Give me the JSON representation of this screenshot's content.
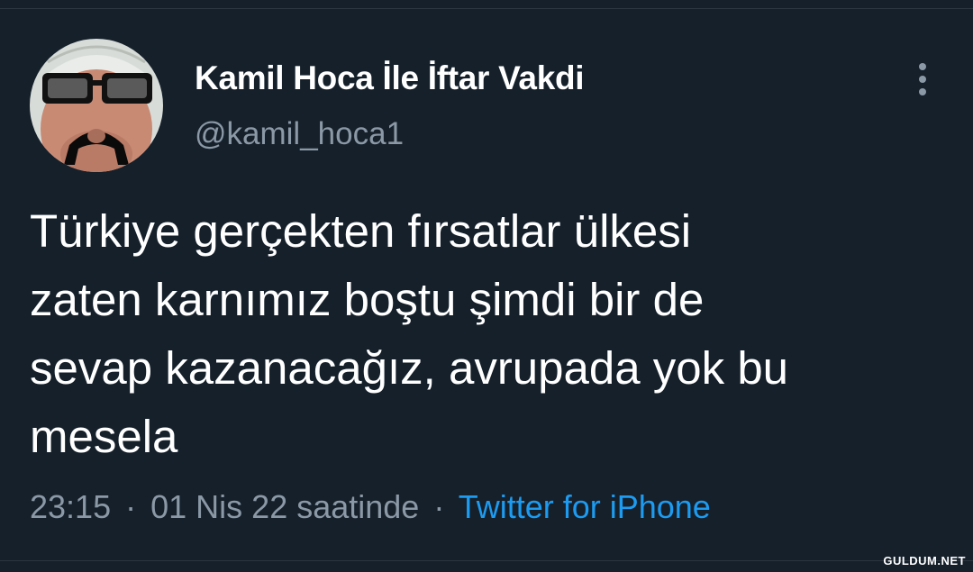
{
  "tweet": {
    "author": {
      "display_name": "Kamil Hoca İle İftar Vakdi",
      "handle": "@kamil_hoca1"
    },
    "text_lines": [
      "Türkiye gerçekten fırsatlar ülkesi",
      "zaten karnımız boştu şimdi bir de",
      "sevap kazanacağız, avrupada yok bu",
      "mesela"
    ],
    "time": "23:15",
    "date": "01 Nis 22 saatinde",
    "separator": "·",
    "source": "Twitter for iPhone"
  },
  "icons": {
    "more": "more-vertical-icon"
  },
  "watermark": "GULDUM.NET",
  "colors": {
    "background": "#15202b",
    "text_primary": "#ffffff",
    "text_secondary": "#8b98a5",
    "accent": "#1d9bf0"
  }
}
